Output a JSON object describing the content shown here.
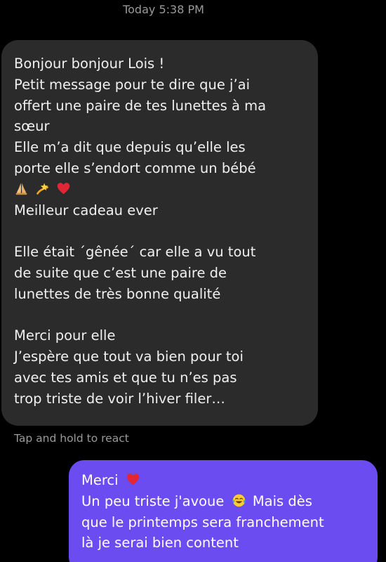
{
  "thread": {
    "timestamp": "Today 5:38 PM",
    "tap_hint": "Tap and hold to react"
  },
  "received_message": {
    "line1": "Bonjour bonjour Lois !",
    "line2": "Petit message pour te dire que j’ai",
    "line3": "offert une paire de tes lunettes à ma",
    "line4": "sœur",
    "line5": "Elle m’a dit que depuis qu’elle les",
    "line6": "porte elle s’endort comme un bébé",
    "line7_emojis": [
      "folded-hands",
      "dizzy",
      "red-heart"
    ],
    "line8": "Meilleur cadeau ever",
    "line9": "Elle était ´gênée´ car elle a vu tout",
    "line10": "de suite que c’est une paire de",
    "line11": "lunettes de très bonne qualité",
    "line12": "Merci pour elle",
    "line13": "J’espère que tout va bien pour toi",
    "line14": "avec tes amis et que tu n’es pas",
    "line15": "trop triste de voir l’hiver filer…"
  },
  "sent_message": {
    "line1_text": "Merci",
    "line2_text": "Un peu triste j'avoue",
    "line2_after": "Mais dès",
    "line3": "que le printemps sera franchement",
    "line4": "là je serai bien content"
  },
  "colors": {
    "background": "#000000",
    "received_bubble": "#2b2b2b",
    "sent_bubble": "#6a4cf0",
    "meta_text": "#9a9a9a"
  }
}
